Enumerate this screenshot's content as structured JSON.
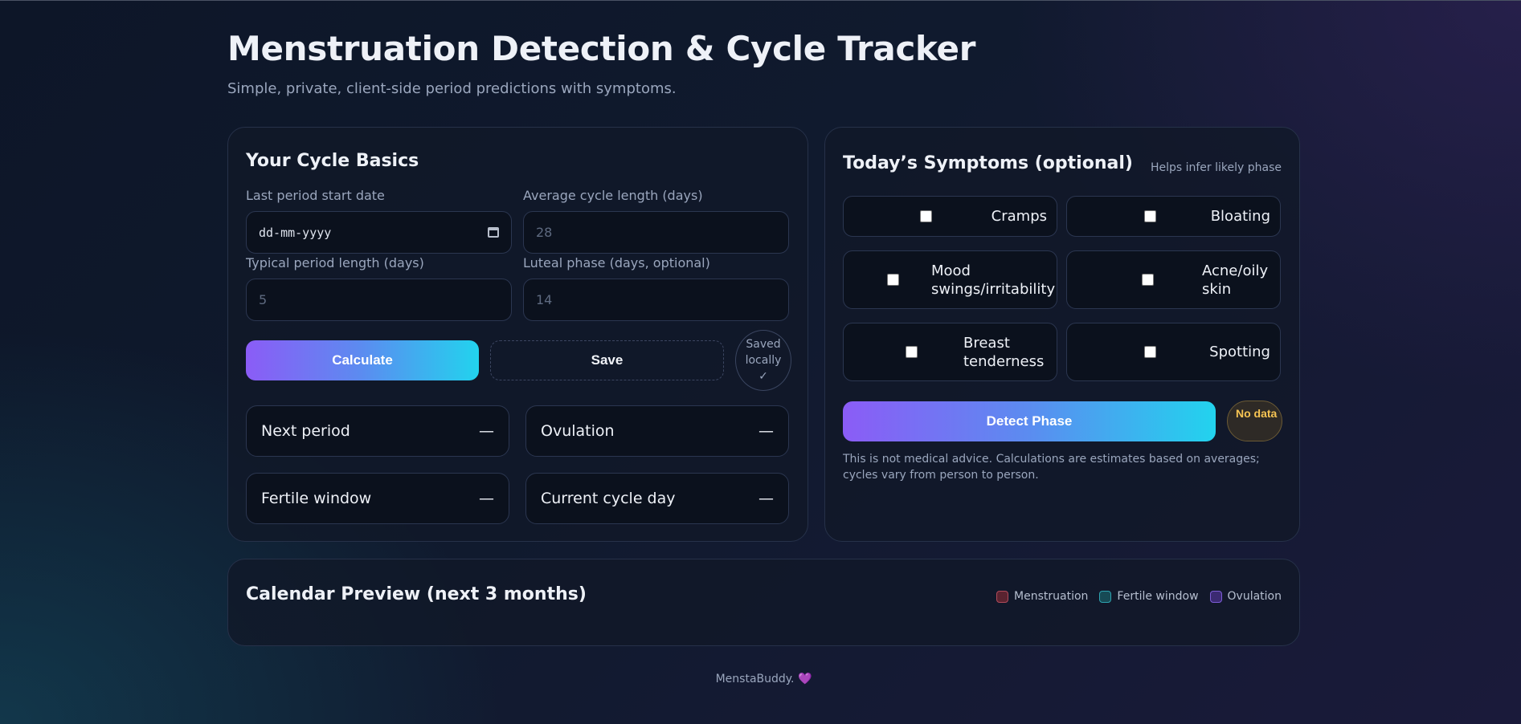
{
  "header": {
    "title": "Menstruation Detection & Cycle Tracker",
    "subtitle": "Simple, private, client-side period predictions with symptoms."
  },
  "basics": {
    "title": "Your Cycle Basics",
    "last_period_label": "Last period start date",
    "last_period_value": "dd-mm-yyyy",
    "cycle_length_label": "Average cycle length (days)",
    "cycle_length_placeholder": "28",
    "period_length_label": "Typical period length (days)",
    "period_length_placeholder": "5",
    "luteal_label": "Luteal phase (days, optional)",
    "luteal_placeholder": "14",
    "calculate_label": "Calculate",
    "save_label": "Save",
    "saved_line1": "Saved",
    "saved_line2": "locally",
    "saved_check": "✓",
    "results": [
      {
        "label": "Next period",
        "value": "—"
      },
      {
        "label": "Ovulation",
        "value": "—"
      },
      {
        "label": "Fertile window",
        "value": "—"
      },
      {
        "label": "Current cycle day",
        "value": "—"
      }
    ]
  },
  "symptoms": {
    "title": "Today’s Symptoms (optional)",
    "hint": "Helps infer likely phase",
    "items": [
      {
        "label": "Cramps",
        "checked": false
      },
      {
        "label": "Bloating",
        "checked": false
      },
      {
        "label": "Mood swings/irritability",
        "checked": false
      },
      {
        "label": "Acne/oily skin",
        "checked": false
      },
      {
        "label": "Breast tenderness",
        "checked": false
      },
      {
        "label": "Spotting",
        "checked": false
      }
    ],
    "detect_label": "Detect Phase",
    "status_badge": "No data",
    "disclaimer": "This is not medical advice. Calculations are estimates based on averages; cycles vary from person to person."
  },
  "calendar": {
    "title": "Calendar Preview (next 3 months)",
    "legend": [
      {
        "label": "Menstruation",
        "color": "#5a2330",
        "border": "#b04a5a"
      },
      {
        "label": "Fertile window",
        "color": "#174a55",
        "border": "#2ea3b0"
      },
      {
        "label": "Ovulation",
        "color": "#3b2a72",
        "border": "#7c5cd6"
      }
    ]
  },
  "footer": {
    "text": "MenstaBuddy.",
    "heart": "💜"
  },
  "colors": {
    "accent_start": "#8b5cf6",
    "accent_end": "#22d3ee",
    "badge_warning": "#f6c453"
  }
}
